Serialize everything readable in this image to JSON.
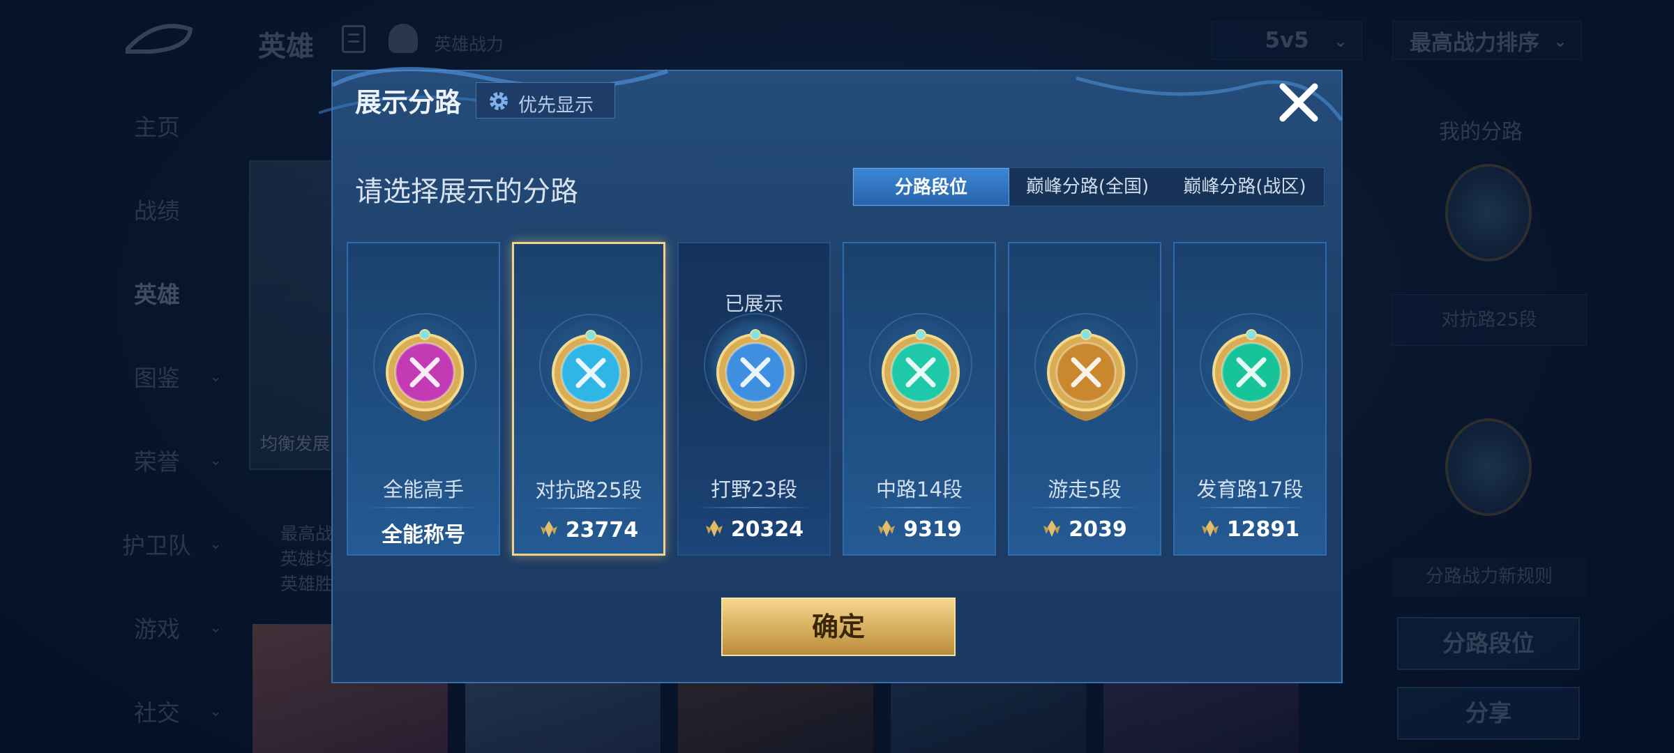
{
  "background": {
    "header": {
      "title": "英雄",
      "subtitle": "英雄战力",
      "mode_select": "5v5",
      "sort_select": "最高战力排序"
    },
    "sidebar": [
      {
        "label": "主页",
        "has_arrow": false
      },
      {
        "label": "战绩",
        "has_arrow": false
      },
      {
        "label": "英雄",
        "has_arrow": false,
        "active": true
      },
      {
        "label": "图鉴",
        "has_arrow": true
      },
      {
        "label": "荣誉",
        "has_arrow": true
      },
      {
        "label": "护卫队",
        "has_arrow": true
      },
      {
        "label": "游戏",
        "has_arrow": true
      },
      {
        "label": "社交",
        "has_arrow": true
      }
    ],
    "hero_card_caption": "均衡发展",
    "hero_info_lines": [
      "最高战",
      "英雄均",
      "英雄胜"
    ],
    "right_panel": {
      "title": "我的分路",
      "current_lane": "对抗路25段",
      "rule_note": "分路战力新规则",
      "lane_rank_button": "分路段位",
      "share_button": "分享"
    }
  },
  "modal": {
    "title": "展示分路",
    "priority_button": "优先显示",
    "prompt": "请选择展示的分路",
    "tabs": [
      {
        "label": "分路段位",
        "active": true
      },
      {
        "label": "巅峰分路(全国)",
        "active": false
      },
      {
        "label": "巅峰分路(战区)",
        "active": false
      }
    ],
    "cards": [
      {
        "name": "全能高手",
        "value": "全能称号",
        "state": "",
        "emblem": "all-round",
        "color": "#c23bb5",
        "show_power_icon": false,
        "selected": false
      },
      {
        "name": "对抗路25段",
        "value": "23774",
        "state": "",
        "emblem": "clash-lane",
        "color": "#2fb6e6",
        "show_power_icon": true,
        "selected": true
      },
      {
        "name": "打野23段",
        "value": "20324",
        "state": "已展示",
        "emblem": "jungle",
        "color": "#3e8fe0",
        "show_power_icon": true,
        "selected": false
      },
      {
        "name": "中路14段",
        "value": "9319",
        "state": "",
        "emblem": "mid-lane",
        "color": "#1fc8a8",
        "show_power_icon": true,
        "selected": false
      },
      {
        "name": "游走5段",
        "value": "2039",
        "state": "",
        "emblem": "roam",
        "color": "#c9872e",
        "show_power_icon": true,
        "selected": false
      },
      {
        "name": "发育路17段",
        "value": "12891",
        "state": "",
        "emblem": "farm-lane",
        "color": "#17c49a",
        "show_power_icon": true,
        "selected": false
      }
    ],
    "confirm_button": "确定"
  },
  "colors": {
    "gold": "#e2bd6e",
    "tab_active": "#3b86d6",
    "panel": "#1e3f69"
  }
}
